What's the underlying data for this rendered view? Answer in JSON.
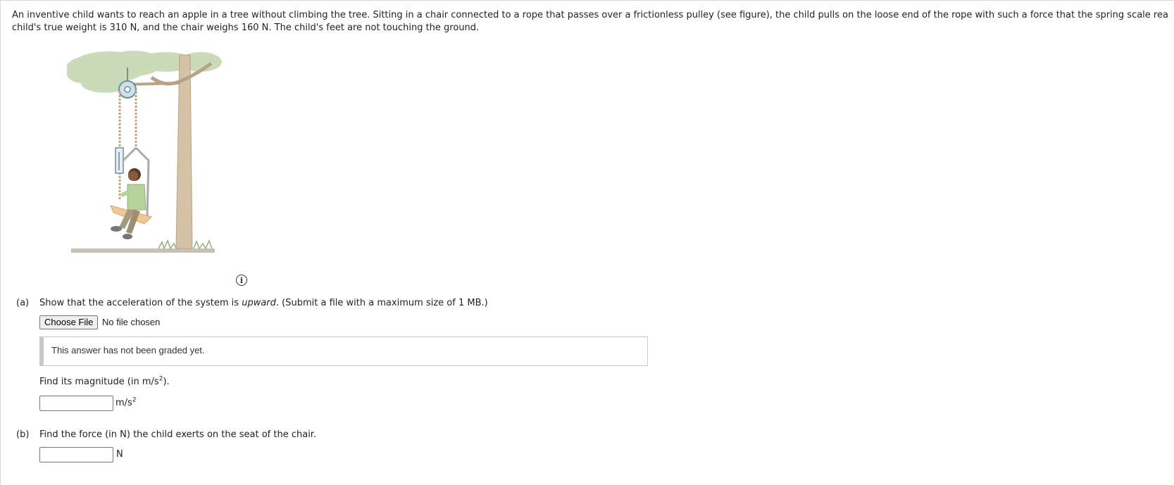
{
  "problem": {
    "line1": "An inventive child wants to reach an apple in a tree without climbing the tree. Sitting in a chair connected to a rope that passes over a frictionless pulley (see figure), the child pulls on the loose end of the rope with such a force that the spring scale rea",
    "line2": "child's true weight is 310 N, and the chair weighs 160 N. The child's feet are not touching the ground."
  },
  "figure": {
    "info_glyph": "i"
  },
  "part_a": {
    "label": "(a)",
    "text_before": "Show that the acceleration of the system is ",
    "text_em": "upward",
    "text_after": ". (Submit a file with a maximum size of 1 MB.)",
    "choose_file_label": "Choose File",
    "no_file_text": "No file chosen",
    "graded_text": "This answer has not been graded yet.",
    "magnitude_prefix": "Find its magnitude (in m/s",
    "magnitude_exp": "2",
    "magnitude_suffix": ").",
    "answer_value": "",
    "unit_base": "m/s",
    "unit_exp": "2"
  },
  "part_b": {
    "label": "(b)",
    "text": "Find the force (in N) the child exerts on the seat of the chair.",
    "answer_value": "",
    "unit": "N"
  }
}
